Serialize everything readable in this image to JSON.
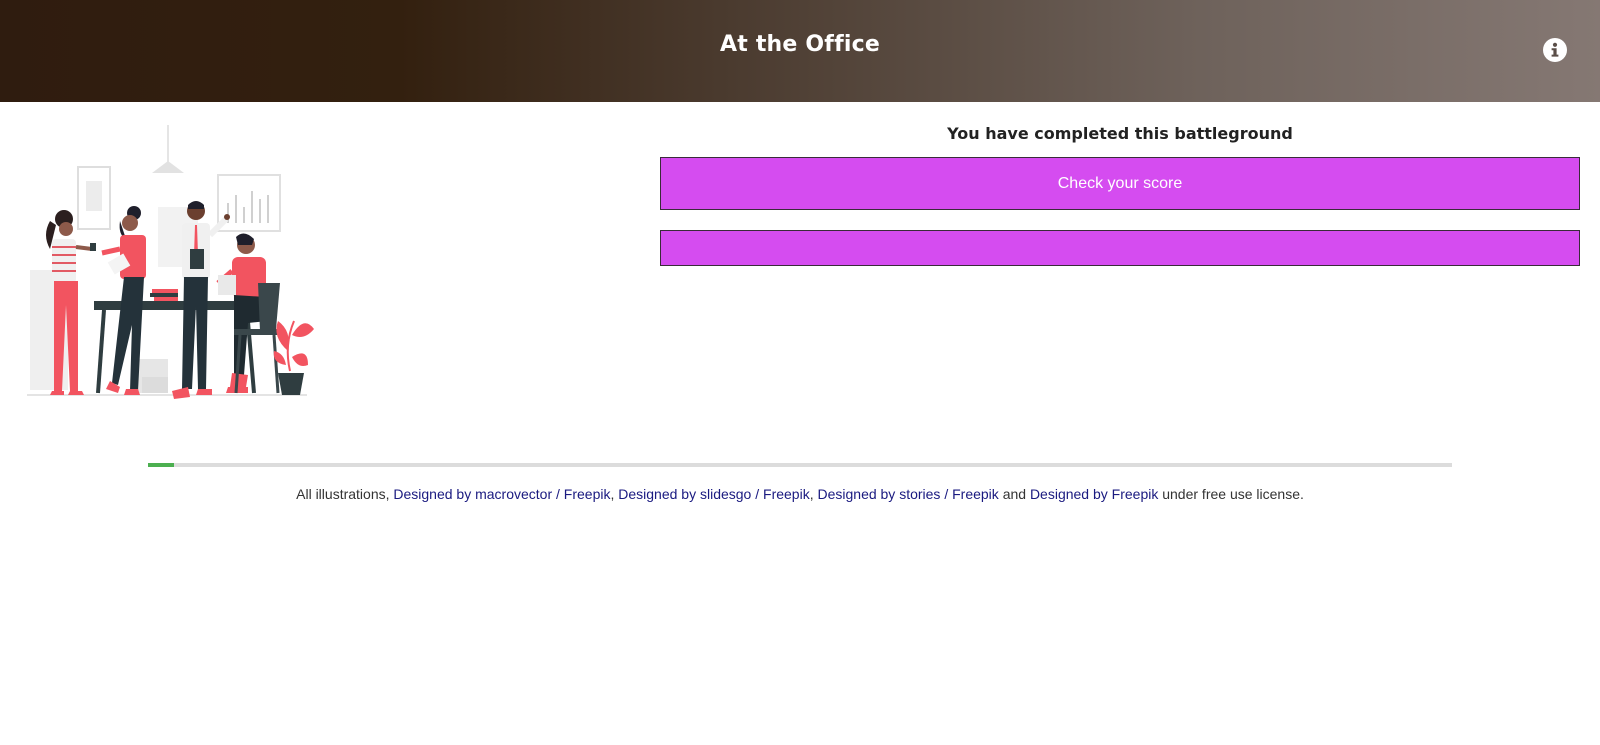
{
  "header": {
    "title": "At the Office",
    "info_icon": "info-icon"
  },
  "main": {
    "completed_message": "You have completed this battleground",
    "check_score_label": "Check your score",
    "second_button_label": "",
    "button_color": "#d54cf0"
  },
  "progress": {
    "value": 0.02,
    "color": "#4caf50"
  },
  "footer": {
    "prefix": "All illustrations,",
    "link1": "Designed by macrovector / Freepik",
    "sep1": ",",
    "link2": "Designed by slidesgo / Freepik",
    "sep2": ",",
    "link3": "Designed by stories / Freepik",
    "and_text": "and",
    "link4": "Designed by Freepik",
    "suffix": "under free use license."
  }
}
